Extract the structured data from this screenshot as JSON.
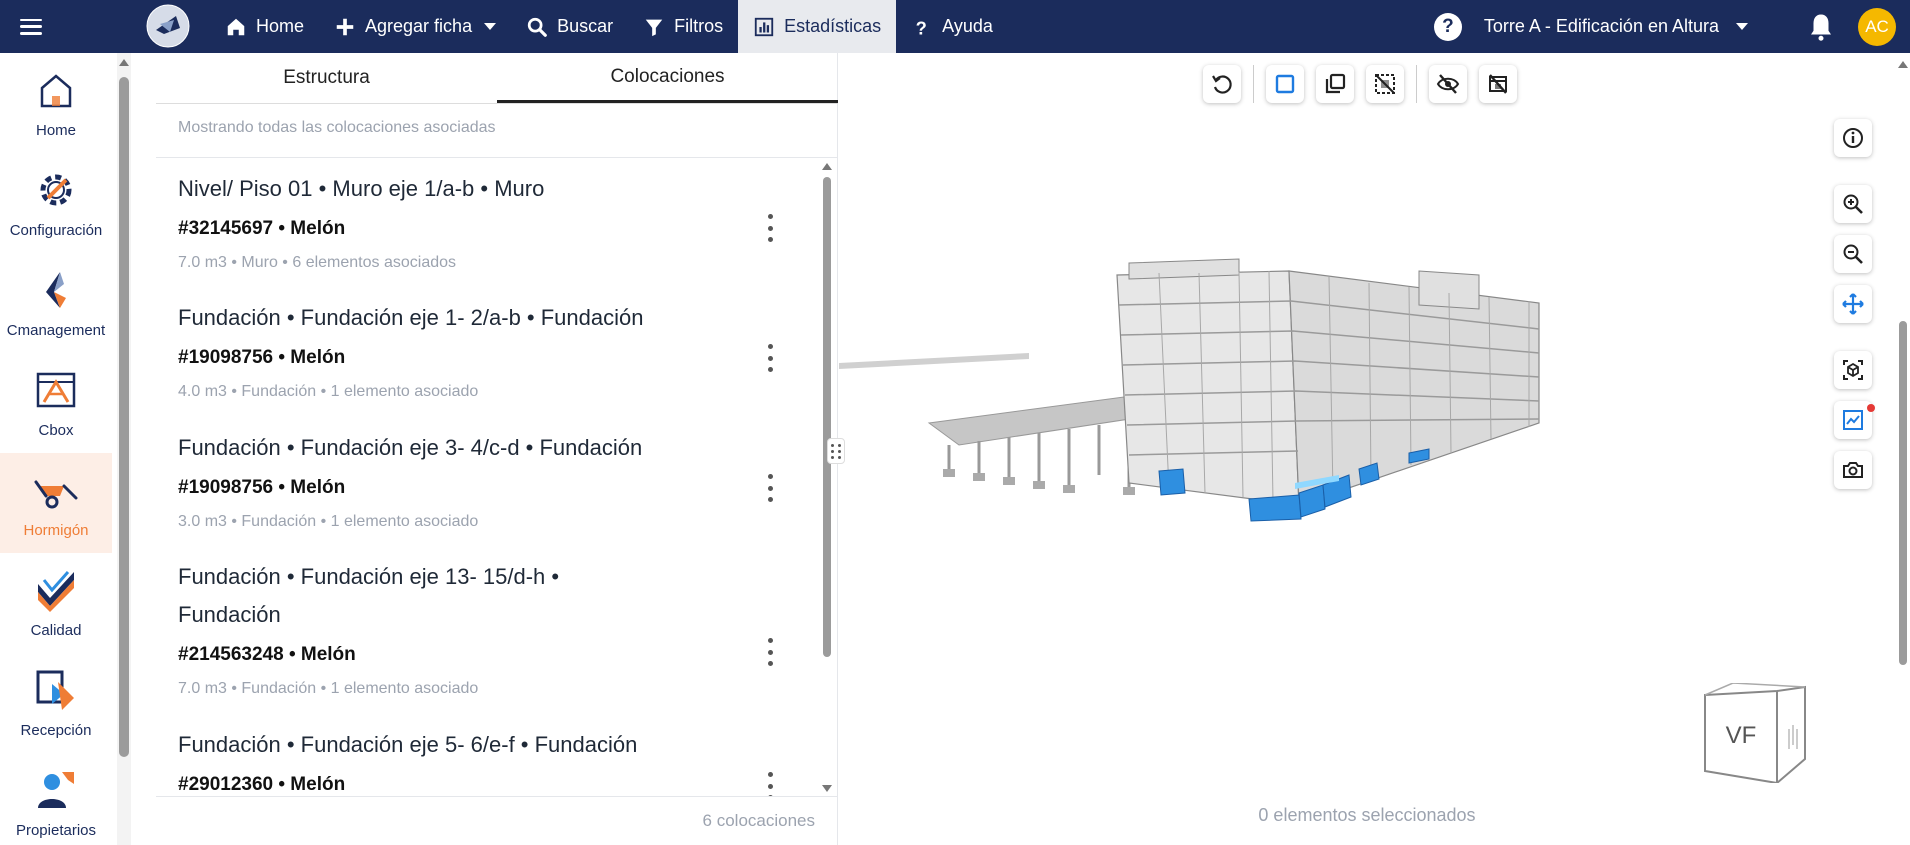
{
  "topbar": {
    "nav": [
      {
        "label": "Home",
        "icon": "home-icon"
      },
      {
        "label": "Agregar ficha",
        "icon": "plus-icon"
      },
      {
        "label": "Buscar",
        "icon": "search-icon"
      },
      {
        "label": "Filtros",
        "icon": "filter-icon"
      },
      {
        "label": "Estadísticas",
        "icon": "bar-chart-icon"
      },
      {
        "label": "Ayuda",
        "icon": "question-icon"
      }
    ],
    "help_glyph": "?",
    "project": "Torre A - Edificación en Altura",
    "avatar_initials": "AC"
  },
  "sidebar": {
    "items": [
      {
        "label": "Home",
        "icon": "house-icon"
      },
      {
        "label": "Configuración",
        "icon": "gear-icon"
      },
      {
        "label": "Cmanagement",
        "icon": "cmanagement-logo-icon"
      },
      {
        "label": "Cbox",
        "icon": "cbox-icon"
      },
      {
        "label": "Hormigón",
        "icon": "wheelbarrow-icon"
      },
      {
        "label": "Calidad",
        "icon": "quality-check-icon"
      },
      {
        "label": "Recepción",
        "icon": "reception-icon"
      },
      {
        "label": "Propietarios",
        "icon": "owners-icon"
      }
    ]
  },
  "panel": {
    "tabs": [
      "Estructura",
      "Colocaciones"
    ],
    "subtitle": "Mostrando todas las colocaciones asociadas",
    "rows": [
      {
        "title": "Nivel/ Piso 01 • Muro eje 1/a-b • Muro",
        "code": "#32145697 • Melón",
        "meta": "7.0 m3 • Muro • 6 elementos asociados"
      },
      {
        "title": "Fundación • Fundación eje 1- 2/a-b • Fundación",
        "code": "#19098756 • Melón",
        "meta": "4.0 m3 • Fundación • 1 elemento asociado"
      },
      {
        "title": "Fundación • Fundación eje 3- 4/c-d • Fundación",
        "code": "#19098756 • Melón",
        "meta": "3.0 m3 • Fundación • 1 elemento asociado"
      },
      {
        "title": "Fundación • Fundación eje 13- 15/d-h • Fundación",
        "code": "#214563248 • Melón",
        "meta": "7.0 m3 • Fundación • 1 elemento asociado"
      },
      {
        "title": "Fundación • Fundación eje 5- 6/e-f • Fundación",
        "code": "#29012360 • Melón",
        "meta": ""
      }
    ],
    "count": "6 colocaciones"
  },
  "viewer": {
    "selected_text": "0 elementos seleccionados",
    "cube_label": "VF",
    "colors": {
      "highlight": "#2f8fe0",
      "building": "#c8c8c8",
      "accent": "#ef7d36"
    }
  }
}
